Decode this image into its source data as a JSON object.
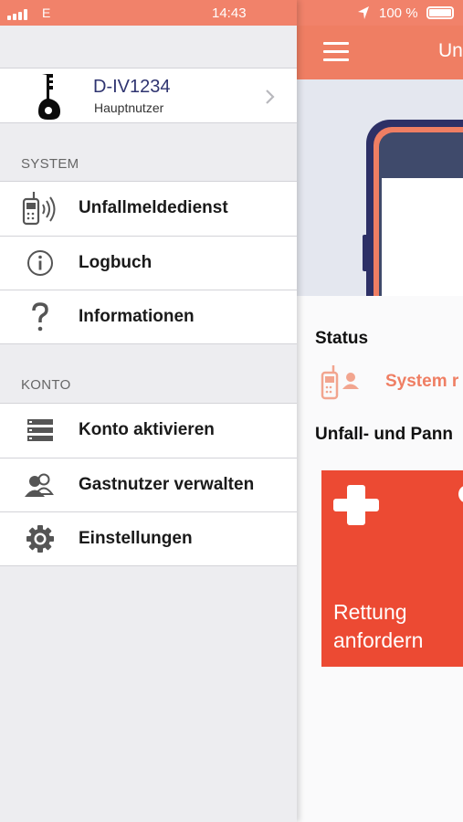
{
  "main_screen": {
    "statusbar": {
      "battery_percent": "100 %"
    },
    "nav_title": "Un",
    "status_label": "Status",
    "status_value": "System r",
    "section_label": "Unfall- und Pann",
    "rescue_tile_label": "Rettung\nanfordern"
  },
  "drawer": {
    "statusbar": {
      "carrier": "E",
      "time": "14:43"
    },
    "profile": {
      "vehicle_id": "D-IV1234",
      "role": "Hauptnutzer"
    },
    "sections": [
      {
        "title": "SYSTEM",
        "items": [
          {
            "label": "Unfallmeldedienst",
            "icon": "phone-signal-icon"
          },
          {
            "label": "Logbuch",
            "icon": "info-icon"
          },
          {
            "label": "Informationen",
            "icon": "question-icon"
          }
        ]
      },
      {
        "title": "KONTO",
        "items": [
          {
            "label": "Konto aktivieren",
            "icon": "server-icon"
          },
          {
            "label": "Gastnutzer verwalten",
            "icon": "users-icon"
          },
          {
            "label": "Einstellungen",
            "icon": "gear-icon"
          }
        ]
      }
    ]
  },
  "colors": {
    "brand_orange": "#ef7e63",
    "statusbar_orange": "#f1826a",
    "alert_red": "#ec4a33",
    "navy": "#2f3470"
  }
}
